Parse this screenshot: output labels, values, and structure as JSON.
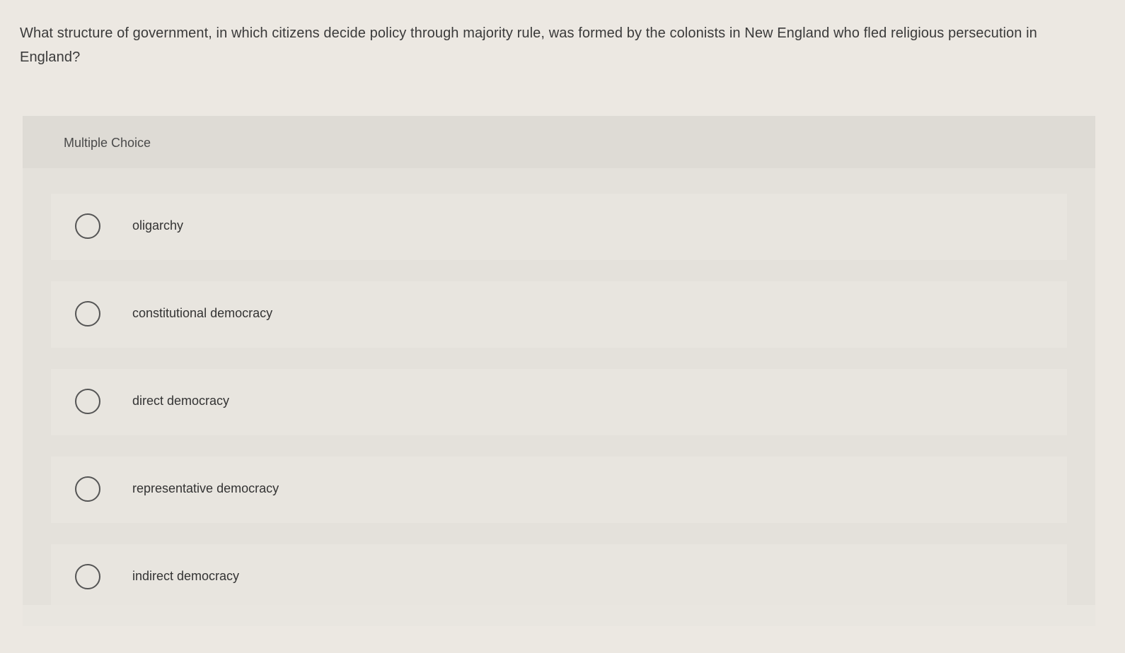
{
  "question": {
    "text": "What structure of government, in which citizens decide policy through majority rule, was formed by the colonists in New England who fled religious persecution in England?"
  },
  "panel": {
    "label": "Multiple Choice"
  },
  "options": [
    {
      "label": "oligarchy"
    },
    {
      "label": "constitutional democracy"
    },
    {
      "label": "direct democracy"
    },
    {
      "label": "representative democracy"
    },
    {
      "label": "indirect democracy"
    }
  ]
}
